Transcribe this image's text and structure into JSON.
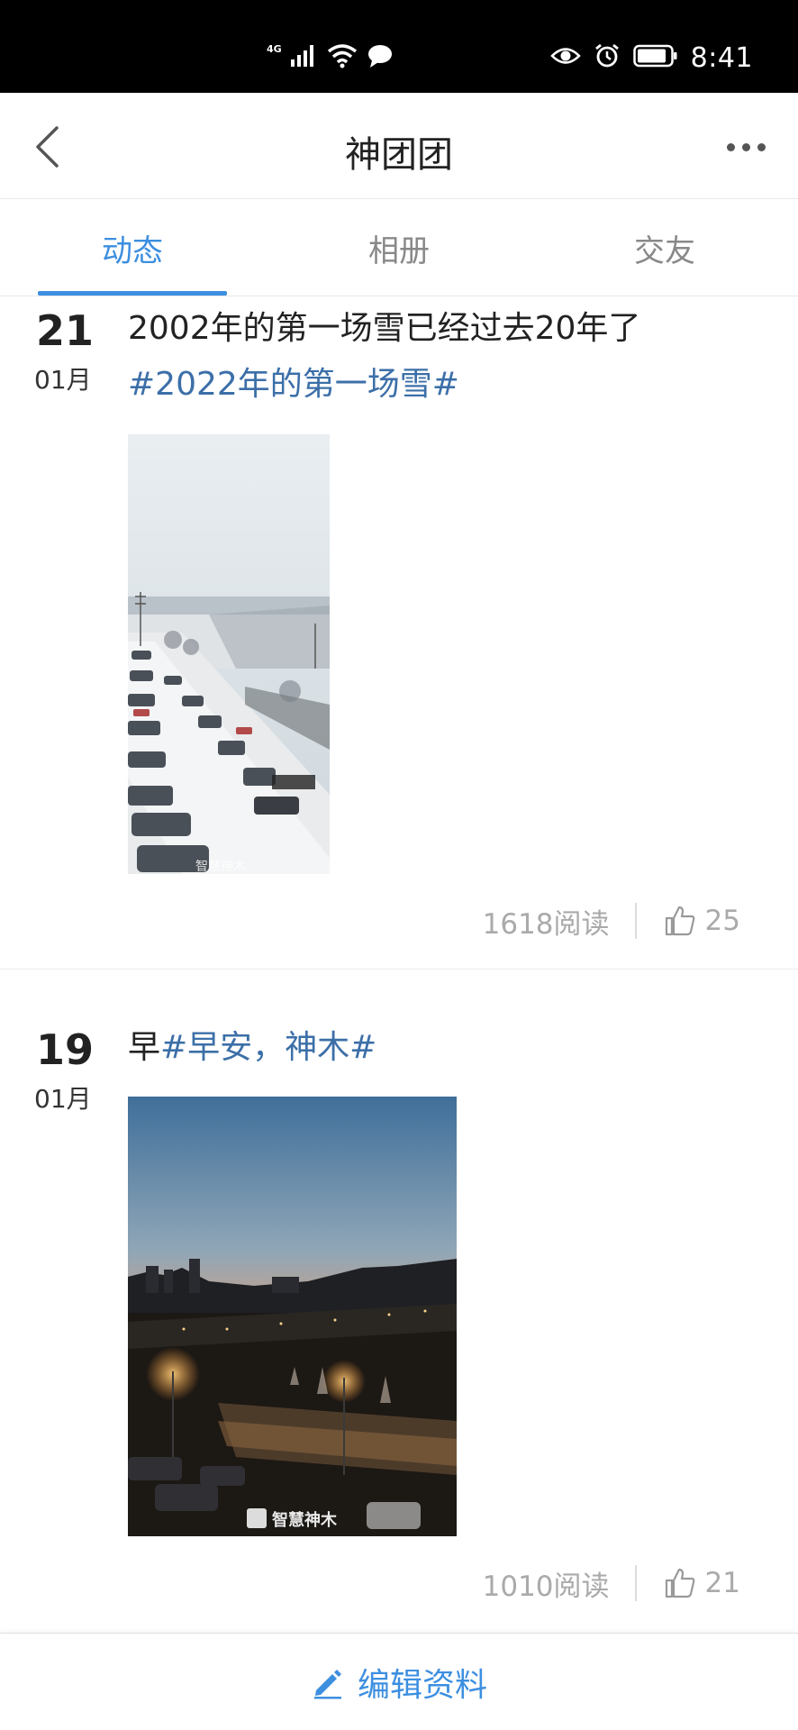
{
  "status_bar": {
    "network": "4G",
    "time": "8:41"
  },
  "header": {
    "title": "神团团"
  },
  "tabs": [
    {
      "label": "动态",
      "active": true
    },
    {
      "label": "相册",
      "active": false
    },
    {
      "label": "交友",
      "active": false
    }
  ],
  "posts": [
    {
      "day": "21",
      "month": "01月",
      "text": "2002年的第一场雪已经过去20年了",
      "tag": "#2022年的第一场雪#",
      "image_desc": "snow-covered-parking-lot",
      "watermark": "智慧神木",
      "reads": "1618阅读",
      "likes": "25"
    },
    {
      "day": "19",
      "month": "01月",
      "text": "早",
      "tag": "#早安，神木#",
      "image_desc": "sunrise-over-city",
      "watermark": "智慧神木",
      "reads": "1010阅读",
      "likes": "21"
    }
  ],
  "bottom_bar": {
    "edit_label": "编辑资料"
  },
  "colors": {
    "accent": "#3d8fe0",
    "tag": "#3c6fa8",
    "muted": "#aaaaaa"
  }
}
